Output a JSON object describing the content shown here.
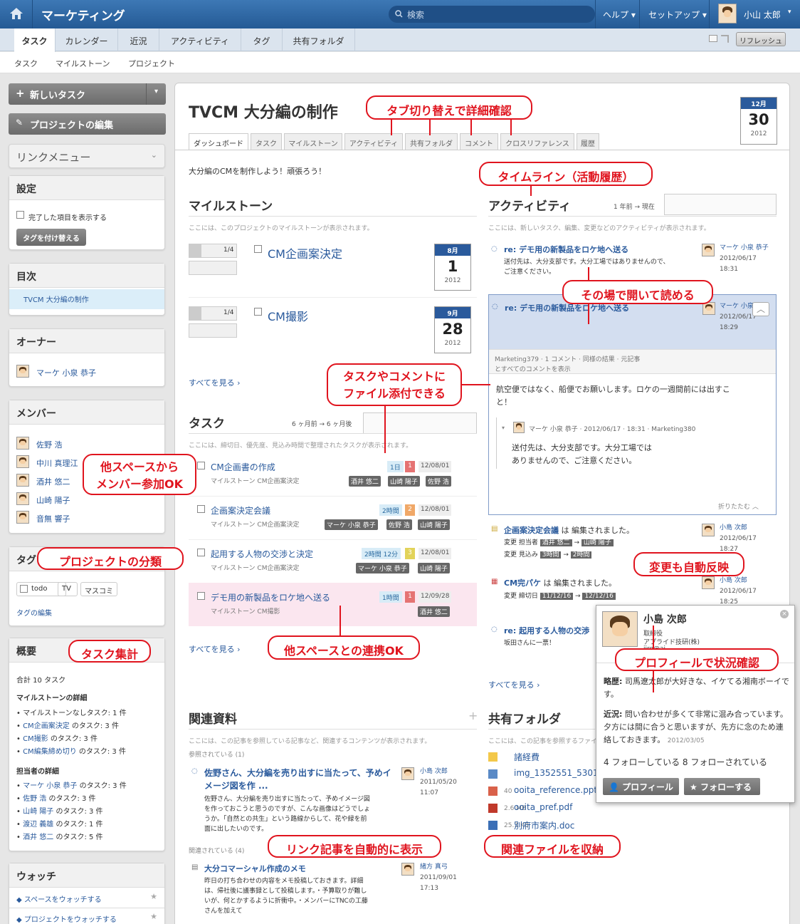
{
  "header": {
    "app_title": "マーケティング",
    "search_placeholder": "検索",
    "help": "ヘルプ",
    "setup": "セットアップ",
    "user_name": "小山 太郎"
  },
  "tabs": [
    "タスク",
    "カレンダー",
    "近況",
    "アクティビティ",
    "タグ",
    "共有フォルダ"
  ],
  "subtabs": [
    "タスク",
    "マイルストーン",
    "プロジェクト"
  ],
  "refresh_label": "リフレッシュ",
  "sidebar": {
    "new_task": "新しいタスク",
    "edit_project": "プロジェクトの編集",
    "link_menu": "リンクメニュー",
    "settings": {
      "title": "設定",
      "show_done": "完了した項目を表示する",
      "retag": "タグを付け替える"
    },
    "toc": {
      "title": "目次",
      "item": "TVCM 大分編の制作"
    },
    "owner": {
      "title": "オーナー",
      "name": "マーケ 小泉 恭子"
    },
    "members": {
      "title": "メンバー",
      "names": [
        "佐野 浩",
        "中川 真理江",
        "酒井 悠二",
        "山崎 陽子",
        "音無 響子"
      ]
    },
    "tags": {
      "title": "タグ",
      "items": [
        "todo",
        "TV",
        "マスコミ"
      ],
      "edit": "タグの編集"
    },
    "summary": {
      "title": "概要",
      "total": "合計 10 タスク",
      "ms_head": "マイルストーンの詳細",
      "ms_items": [
        {
          "link": "",
          "text": "マイルストーンなしタスク: 1 件"
        },
        {
          "link": "CM企画案決定",
          "text": " のタスク: 3 件"
        },
        {
          "link": "CM撮影",
          "text": " のタスク: 3 件"
        },
        {
          "link": "CM編集締め切り",
          "text": " のタスク: 3 件"
        }
      ],
      "as_head": "担当者の詳細",
      "as_items": [
        {
          "link": "マーケ 小泉 恭子",
          "text": " のタスク: 3 件"
        },
        {
          "link": "佐野 浩",
          "text": " のタスク: 3 件"
        },
        {
          "link": "山崎 陽子",
          "text": " のタスク: 3 件"
        },
        {
          "link": "渡辺 義雄",
          "text": " のタスク: 1 件"
        },
        {
          "link": "酒井 悠二",
          "text": " のタスク: 5 件"
        }
      ]
    },
    "watch": {
      "title": "ウォッチ",
      "space": "スペースをウォッチする",
      "project": "プロジェクトをウォッチする"
    }
  },
  "project": {
    "title": "TVCM 大分編の制作",
    "date": {
      "month": "12月",
      "day": "30",
      "year": "2012"
    },
    "tabs": [
      "ダッシュボード",
      "タスク",
      "マイルストーン",
      "アクティビティ",
      "共有フォルダ",
      "コメント",
      "クロスリファレンス",
      "履歴"
    ],
    "description": "大分編のCMを制作しよう！頑張ろう！",
    "milestones": {
      "title": "マイルストーン",
      "desc": "ここには、このプロジェクトのマイルストーンが表示されます。",
      "items": [
        {
          "progress": "1/4",
          "name": "CM企画案決定",
          "month": "8月",
          "day": "1",
          "year": "2012"
        },
        {
          "progress": "1/4",
          "name": "CM撮影",
          "month": "9月",
          "day": "28",
          "year": "2012"
        }
      ],
      "see_all": "すべてを見る"
    },
    "tasks": {
      "title": "タスク",
      "range": "6 ヶ月前 → 6 ヶ月後",
      "desc": "ここには、締切日、優先度、見込み時間で整理されたタスクが表示されます。",
      "items": [
        {
          "name": "CM企画書の作成",
          "ms": "マイルストーン CM企画案決定",
          "est": "1日",
          "pri": "1",
          "due": "12/08/01",
          "tags": [
            "酒井 悠二",
            "山崎 陽子",
            "佐野 浩"
          ]
        },
        {
          "name": "企画案決定会議",
          "ms": "マイルストーン CM企画案決定",
          "est": "2時間",
          "pri": "2",
          "due": "12/08/01",
          "tags": [
            "マーケ 小泉 恭子",
            "佐野 浩",
            "山崎 陽子"
          ]
        },
        {
          "name": "起用する人物の交渉と決定",
          "ms": "マイルストーン CM企画案決定",
          "est": "2時間 12分",
          "pri": "3",
          "due": "12/08/01",
          "tags": [
            "マーケ 小泉 恭子",
            "山崎 陽子"
          ]
        },
        {
          "name": "デモ用の新製品をロケ地へ送る",
          "ms": "マイルストーン CM撮影",
          "est": "1時間",
          "pri": "1",
          "due": "12/09/28",
          "tags": [
            "酒井 悠二"
          ]
        }
      ],
      "see_all": "すべてを見る"
    },
    "activity": {
      "title": "アクティビティ",
      "range": "1 年前 → 現在",
      "desc": "ここには、新しいタスク、編集、変更などのアクティビティが表示されます。",
      "item1": {
        "title": "re: デモ用の新製品をロケ地へ送る",
        "body1": "送付先は、大分支部です。大分工場ではありませんので、",
        "body2": "ご注意ください。",
        "user": "マーケ 小泉 恭子",
        "date": "2012/06/17",
        "time": "18:31"
      },
      "item2": {
        "title": "re: デモ用の新製品をロケ地へ送る",
        "user": "マーケ 小泉 恭子",
        "date": "2012/06/17",
        "time": "18:29",
        "meta": "Marketing379 · 1 コメント · 同様の結果 · 元記事",
        "show_all": "とすべてのコメントを表示",
        "body1": "航空便ではなく、船便でお願いします。ロケの一週間前には出すこ",
        "body2": "と！",
        "reply_meta": "マーケ 小泉 恭子 · 2012/06/17 · 18:31 · Marketing380",
        "reply1": "送付先は、大分支部です。大分工場では",
        "reply2": "ありませんので、ご注意ください。",
        "fold": "折りたたむ"
      },
      "item3": {
        "title": "企画案決定会議",
        "suffix": " は 編集されました。",
        "l1a": "変更 担当者",
        "l1b": "酒井 悠二",
        "l1c": "山崎 陽子",
        "l2a": "変更 見込み",
        "l2b": "3時間",
        "l2c": "2時間",
        "user": "小島 次郎",
        "date": "2012/06/17",
        "time": "18:27"
      },
      "item4": {
        "title": "CM完パケ",
        "suffix": " は 編集されました。",
        "l1a": "変更 締切日",
        "l1b": "11/12/16",
        "l1c": "12/12/16",
        "user": "小島 次郎",
        "date": "2012/06/17",
        "time": "18:25"
      },
      "item5": {
        "title": "re: 起用する人物の交渉",
        "body": "坂田さんに一票！"
      },
      "see_all": "すべてを見る"
    },
    "related": {
      "title": "関連資料",
      "desc": "ここには、この記事を参照している記事など、関連するコンテンツが表示されます。",
      "ref_count": "参照されている (1)",
      "item1": {
        "title1": "佐野さん、大分編を売り出すに当たって、予めイ",
        "title2": "メージ図を作 ...",
        "body": [
          "佐野さん、大分編を売り出すに当たって、予めイメージ図",
          "を作っておこうと思うのですが、こんな画像はどうでしょ",
          "うか。「自然との共生」という路線からして、花や緑を前",
          "面に出したいのです。"
        ],
        "user": "小島 次郎",
        "date": "2011/05/20",
        "time": "11:07"
      },
      "rel_count": "関連されている (4)",
      "item2": {
        "title": "大分コマーシャル作成のメモ",
        "body": [
          "昨日の打ち合わせの内容をメモ投稿しておきます。詳細",
          "は、帰社後に議事録として投稿します。・予算取りが難し",
          "いが、何とかするように折衝中。・メンバーにTNCの工藤",
          "さんを加えて"
        ],
        "user": "緒方 真弓",
        "date": "2011/09/01",
        "time": "17:13"
      }
    },
    "shared": {
      "title": "共有フォルダ",
      "desc": "ここには、この記事を参照するファイルや記",
      "files": [
        {
          "name": "諸経費",
          "size": ""
        },
        {
          "name": "img_1352551_5301702",
          "size": ""
        },
        {
          "name": "ooita_reference.ppt",
          "size": "40"
        },
        {
          "name": "ooita_pref.pdf",
          "size": "2.6 MB"
        },
        {
          "name": "別府市案内.doc",
          "size": "25.3 KB"
        }
      ]
    }
  },
  "profile": {
    "name": "小島 次郎",
    "role": "取締役",
    "company": "アプライド技研(株)",
    "email": "jiro@ai",
    "bio_label": "略歴:",
    "bio": "司馬遼太郎が大好きな、イケてる湘南ボーイです。",
    "status_label": "近況:",
    "status": "問い合わせが多くて非常に混み合っています。夕方には間に合うと思いますが、先方に念のため連絡しておきます。",
    "status_date": "2012/03/05",
    "follow_stat": "4 フォローしている 8 フォローされている",
    "btn_profile": "プロフィール",
    "btn_follow": "フォローする"
  },
  "callouts": {
    "tab_switch": "タブ切り替えで詳細確認",
    "timeline": "タイムライン（活動履歴）",
    "read_inline": "その場で開いて読める",
    "attach": "タスクやコメントに\nファイル添付できる",
    "members": "他スペースから\nメンバー参加OK",
    "classify": "プロジェクトの分類",
    "summary": "タスク集計",
    "link_other": "他スペースとの連携OK",
    "auto_reflect": "変更も自動反映",
    "profile": "プロフィールで状況確認",
    "auto_link": "リンク記事を自動的に表示",
    "store": "関連ファイルを収納"
  }
}
